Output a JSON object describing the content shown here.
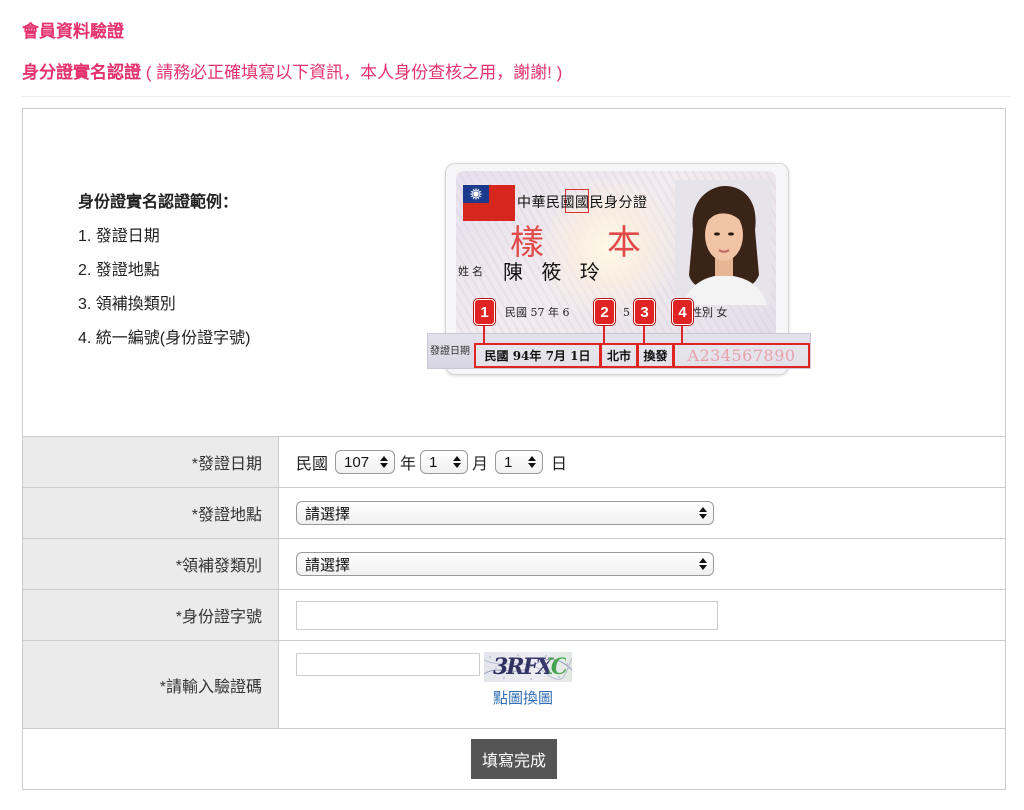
{
  "page": {
    "title": "會員資料驗證",
    "section_title": "身分證實名認證",
    "section_note": "( 請務必正確填寫以下資訊，本人身份查核之用，謝謝! )"
  },
  "example": {
    "heading": "身份證實名認證範例：",
    "items": [
      "1. 發證日期",
      "2. 發證地點",
      "3. 領補換類別",
      "4. 統一編號(身份證字號)"
    ]
  },
  "id_card": {
    "title": "中華民國國民身分證",
    "watermark_left": "樣",
    "watermark_right": "本",
    "name_label": "姓名",
    "name": "陳 筱 玲",
    "birth": "民國 57 年 6",
    "birth_day": "5",
    "sex": "性別 女",
    "issue_label": "發證日期",
    "issue_date": "民國 94年 7月 1日",
    "issue_place": "北市",
    "issue_type": "換發",
    "id_number": "A234567890",
    "markers": [
      "1",
      "2",
      "3",
      "4"
    ]
  },
  "form": {
    "issue_date": {
      "label": "*發證日期",
      "era": "民國",
      "year": "107",
      "year_unit": "年",
      "month": "1",
      "month_unit": "月",
      "day": "1",
      "day_unit": "日"
    },
    "issue_place": {
      "label": "*發證地點",
      "selected": "請選擇"
    },
    "issue_type": {
      "label": "*領補發類別",
      "selected": "請選擇"
    },
    "id_number": {
      "label": "*身份證字號",
      "value": ""
    },
    "captcha": {
      "label": "*請輸入驗證碼",
      "value": "",
      "image_text": "3RFXC",
      "refresh_link": "點圖換圖"
    },
    "submit_label": "填寫完成"
  },
  "icons": {
    "flag": "taiwan-flag-icon",
    "select_arrow": "up-down-arrow-icon"
  },
  "colors": {
    "accent": "#e4326e",
    "label_bg": "#ebebeb",
    "border": "#cccccc",
    "link": "#2f6eb5",
    "button_bg": "#555555",
    "marker": "#e02424"
  }
}
